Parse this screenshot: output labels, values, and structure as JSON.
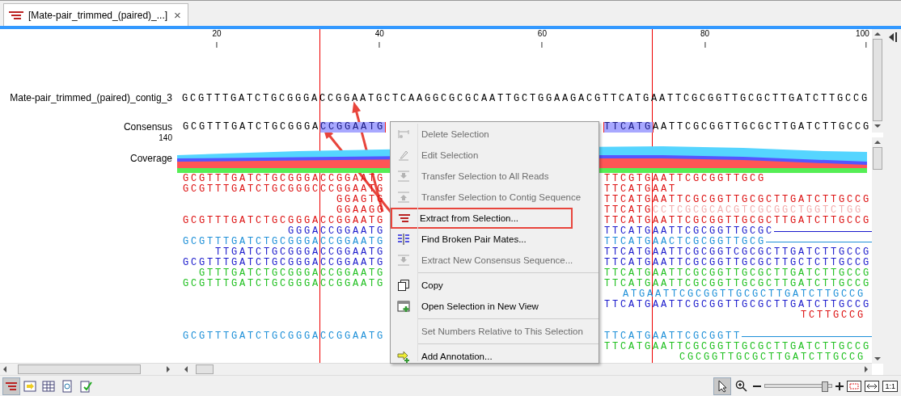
{
  "tab": {
    "title": "[Mate-pair_trimmed_(paired)_...]",
    "close": "×",
    "selected": true
  },
  "ruler": {
    "ticks": [
      "20",
      "40",
      "60",
      "80",
      "100"
    ]
  },
  "contig": {
    "name": "Mate-pair_trimmed_(paired)_contig_3",
    "sequence": "GCGTTTGATCTGCGGGACCGGAATGCTCAAGGCGCGCAATTGCTGGAAGACGTTCATGAATTCGCGGTTGCGCTTGATCTTGCCG"
  },
  "consensus": {
    "label": "Consensus",
    "max_coverage": "140",
    "left": [
      {
        "text": "GCGTTTGATCTGCGGGA",
        "selected": false
      },
      {
        "text": "CCGGAATG",
        "selected": true
      }
    ],
    "right": [
      {
        "text": "TTCATG",
        "selected": true
      },
      {
        "text": "AATTCGCGGTTGCGCTTGATCTTGCCG",
        "selected": false
      }
    ]
  },
  "coverage": {
    "label": "Coverage"
  },
  "reads": [
    {
      "kind": "read",
      "color": "#dd1111",
      "left": "GCGTTTGATCTGCGGGACCGGAATG",
      "flush_right": false,
      "right": [
        {
          "text": "TTCGTGAATTCGCGGTTGCG",
          "faded": false
        }
      ]
    },
    {
      "kind": "read",
      "color": "#dd1111",
      "left": "GCGTTTGATCTGCGGGCCCGGAATG",
      "flush_right": false,
      "right": [
        {
          "text": "TTCATGAAT",
          "faded": false
        }
      ]
    },
    {
      "kind": "read",
      "color": "#dd1111",
      "left": "GGAGTG",
      "flush_right": false,
      "right": [
        {
          "text": "TTCATGAATTCGCGGTTGCGCTTGATCTTGCCG",
          "faded": false
        }
      ]
    },
    {
      "kind": "read",
      "color": "#dd1111",
      "left": "GGAAGG",
      "flush_right": false,
      "right": [
        {
          "text": "TTCATG",
          "faded": false
        },
        {
          "text": "CCTCGCGCACGTCGCGGCTGGTCTGG",
          "faded": true
        }
      ]
    },
    {
      "kind": "read",
      "color": "#dd1111",
      "left": "GCGTTTGATCTGCGGGACCGGAATG",
      "flush_right": false,
      "right": [
        {
          "text": "TTCATGAATTCGCGGTTGCGCTTGATCTTGCCG",
          "faded": false
        }
      ]
    },
    {
      "kind": "read",
      "color": "#1a1acc",
      "left": "GGGACCGGAATG",
      "flush_right": false,
      "right": [
        {
          "text": "TTCATGAATTCGCGGTTGCGC",
          "faded": false
        }
      ],
      "line": true
    },
    {
      "kind": "read",
      "color": "#1e90d8",
      "left": "GCGTTTGATCTGCGGGACCGGAATG",
      "flush_right": false,
      "right": [
        {
          "text": "TTCATGAACTCGCGGTTGCG",
          "faded": false
        }
      ],
      "line": true
    },
    {
      "kind": "read",
      "color": "#1a1acc",
      "left": "TTGATCTGCGGGACCGGAATG",
      "flush_right": false,
      "right": [
        {
          "text": "TTCATGAATTCGCGGTCGCGCTTGATCTTGCCG",
          "faded": false
        }
      ]
    },
    {
      "kind": "read",
      "color": "#1a1acc",
      "left": "GCGTTTGATCTGCGGGACCGGAATG",
      "flush_right": false,
      "right": [
        {
          "text": "TTCATGAATTCGCGGTTGCGCTTGCTCTTGCCG",
          "faded": false
        }
      ]
    },
    {
      "kind": "read",
      "color": "#20c020",
      "left": "GTTTGATCTGCGGGACCGGAATG",
      "flush_right": false,
      "right": [
        {
          "text": "TTCATGAATTCGCGGTTGCGCTTGATCTTGCCG",
          "faded": false
        }
      ]
    },
    {
      "kind": "read",
      "color": "#20c020",
      "left": "GCGTTTGATCTGCGGGACCGGAATG",
      "flush_right": false,
      "right": [
        {
          "text": "TTCATGAATTCGCGGTTGCGCTTGATCTTGCCG",
          "faded": false
        }
      ]
    },
    {
      "kind": "read",
      "color": "#1e90d8",
      "flush_right": true,
      "right": [
        {
          "text": "ATGAATTCGCGGTTGCGCTTGATCTTGCCG",
          "faded": false
        }
      ]
    },
    {
      "kind": "read",
      "color": "#1a1acc",
      "flush_right": false,
      "right": [
        {
          "text": "TTCATGAATTCGCGGTTGCGCTTGATCTTGCCG",
          "faded": false
        }
      ]
    },
    {
      "kind": "read",
      "color": "#dd1111",
      "flush_right": true,
      "right": [
        {
          "text": "TCTTGCCG",
          "faded": false
        }
      ]
    },
    {
      "kind": "gap"
    },
    {
      "kind": "read",
      "color": "#1e90d8",
      "left": "GCGTTTGATCTGCGGGACCGGAATG",
      "flush_right": false,
      "right": [
        {
          "text": "TTCATGAATTCGCGGTT",
          "faded": false
        }
      ],
      "line": true
    },
    {
      "kind": "read",
      "color": "#20c020",
      "flush_right": false,
      "right": [
        {
          "text": "TTCATGAATTCGCGGTTGCGCTTGATCTTGCCG",
          "faded": false
        }
      ]
    },
    {
      "kind": "read",
      "color": "#20c020",
      "flush_right": true,
      "right": [
        {
          "text": "CGCGGTTGCGCTTGATCTTGCCG",
          "faded": false
        }
      ]
    }
  ],
  "menu": [
    {
      "kind": "item",
      "label": "Delete Selection",
      "disabled": true,
      "highlighted": false
    },
    {
      "kind": "item",
      "label": "Edit Selection",
      "disabled": true,
      "highlighted": false
    },
    {
      "kind": "item",
      "label": "Transfer Selection to All Reads",
      "disabled": true,
      "highlighted": false
    },
    {
      "kind": "item",
      "label": "Transfer Selection to Contig Sequence",
      "disabled": true,
      "highlighted": false
    },
    {
      "kind": "item",
      "label": "Extract from Selection...",
      "disabled": false,
      "highlighted": true
    },
    {
      "kind": "item",
      "label": "Find Broken Pair Mates...",
      "disabled": false,
      "highlighted": false
    },
    {
      "kind": "item",
      "label": "Extract New Consensus Sequence...",
      "disabled": true,
      "highlighted": false
    },
    {
      "kind": "separator"
    },
    {
      "kind": "item",
      "label": "Copy",
      "disabled": false,
      "highlighted": false
    },
    {
      "kind": "item",
      "label": "Open Selection in New View",
      "disabled": false,
      "highlighted": false
    },
    {
      "kind": "separator"
    },
    {
      "kind": "item",
      "label": "Set Numbers Relative to This Selection",
      "disabled": true,
      "highlighted": false
    },
    {
      "kind": "separator"
    },
    {
      "kind": "item",
      "label": "Add Annotation...",
      "disabled": false,
      "highlighted": false
    }
  ],
  "toolbar": {
    "views": [
      {
        "selected": true
      },
      {
        "selected": false
      },
      {
        "selected": false
      },
      {
        "selected": false
      },
      {
        "selected": false
      }
    ],
    "tools": [
      {
        "selected": true
      },
      {
        "selected": false
      }
    ],
    "zoom": {
      "level": 0.88
    },
    "actual_size": "1:1"
  }
}
